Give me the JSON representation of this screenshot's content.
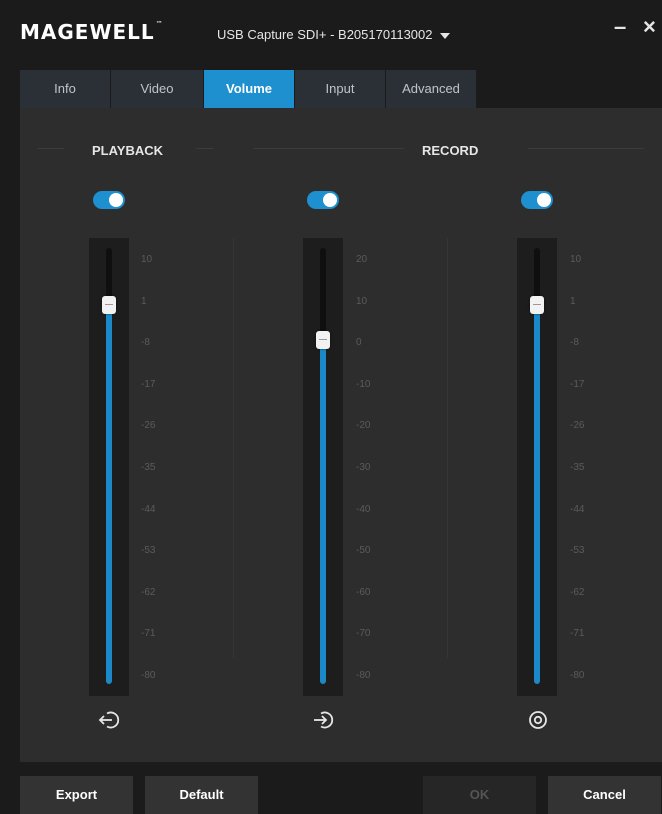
{
  "app": {
    "logo": "MAGEWELL",
    "trademark": "™",
    "device": "USB Capture SDI+ - B205170113002"
  },
  "window_controls": {
    "minimize": "–",
    "close": "×"
  },
  "tabs": [
    {
      "label": "Info",
      "active": false
    },
    {
      "label": "Video",
      "active": false
    },
    {
      "label": "Volume",
      "active": true
    },
    {
      "label": "Input",
      "active": false
    },
    {
      "label": "Advanced",
      "active": false
    }
  ],
  "sections": {
    "playback": "PLAYBACK",
    "record": "RECORD"
  },
  "channels": [
    {
      "group": "playback",
      "enabled": true,
      "level_fraction": 0.87,
      "ticks": [
        "10",
        "1",
        "-8",
        "-17",
        "-26",
        "-35",
        "-44",
        "-53",
        "-62",
        "-71",
        "-80"
      ],
      "icon": "output-icon"
    },
    {
      "group": "record",
      "enabled": true,
      "level_fraction": 0.79,
      "ticks": [
        "20",
        "10",
        "0",
        "-10",
        "-20",
        "-30",
        "-40",
        "-50",
        "-60",
        "-70",
        "-80"
      ],
      "icon": "input-icon"
    },
    {
      "group": "record",
      "enabled": true,
      "level_fraction": 0.87,
      "ticks": [
        "10",
        "1",
        "-8",
        "-17",
        "-26",
        "-35",
        "-44",
        "-53",
        "-62",
        "-71",
        "-80"
      ],
      "icon": "monitor-icon"
    }
  ],
  "footer": {
    "export": "Export",
    "default": "Default",
    "ok": "OK",
    "cancel": "Cancel"
  },
  "colors": {
    "accent": "#1e8fcf",
    "fill": "#1b88c8",
    "background": "#2d2d2d"
  }
}
